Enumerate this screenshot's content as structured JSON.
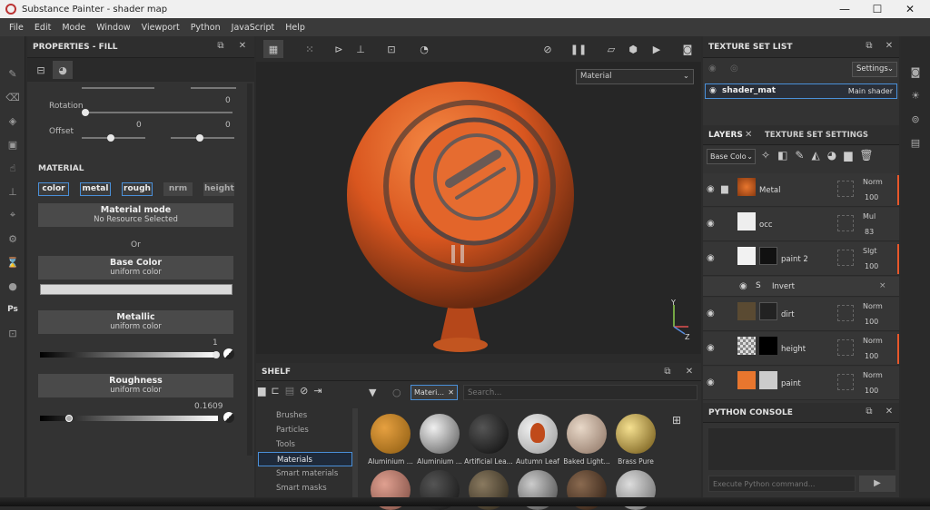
{
  "window": {
    "title": "Substance Painter - shader map",
    "controls": [
      "—",
      "☐",
      "✕"
    ]
  },
  "menu": [
    "File",
    "Edit",
    "Mode",
    "Window",
    "Viewport",
    "Python",
    "JavaScript",
    "Help"
  ],
  "properties": {
    "title": "PROPERTIES - FILL",
    "rotation": {
      "label": "Rotation",
      "value": "0"
    },
    "offset": {
      "label": "Offset",
      "value_x": "0",
      "value_y": "0"
    },
    "material_header": "MATERIAL",
    "channels": [
      {
        "label": "color",
        "on": true
      },
      {
        "label": "metal",
        "on": true
      },
      {
        "label": "rough",
        "on": true
      },
      {
        "label": "nrm",
        "on": false
      },
      {
        "label": "height",
        "on": false
      }
    ],
    "material_mode": {
      "title": "Material mode",
      "sub": "No Resource Selected"
    },
    "or_label": "Or",
    "base_color": {
      "title": "Base Color",
      "sub": "uniform color"
    },
    "metallic": {
      "title": "Metallic",
      "sub": "uniform color",
      "value": "1"
    },
    "roughness": {
      "title": "Roughness",
      "sub": "uniform color",
      "value": "0.1609"
    }
  },
  "viewport": {
    "material_dropdown": "Material",
    "axes": {
      "y": "Y",
      "z": "Z"
    }
  },
  "shelf": {
    "title": "SHELF",
    "filter_tag": "Materi...",
    "search_placeholder": "Search...",
    "categories": [
      "Brushes",
      "Particles",
      "Tools",
      "Materials",
      "Smart materials",
      "Smart masks"
    ],
    "selected_category": "Materials",
    "materials": [
      "Aluminium ...",
      "Aluminium ...",
      "Artificial Lea...",
      "Autumn Leaf",
      "Baked Light...",
      "Brass Pure"
    ]
  },
  "texture_set_list": {
    "title": "TEXTURE SET LIST",
    "settings_label": "Settings",
    "item_name": "shader_mat",
    "item_shader": "Main shader"
  },
  "layers": {
    "tab_layers": "LAYERS",
    "tab_tss": "TEXTURE SET SETTINGS",
    "channel_dropdown": "Base Colo",
    "items": [
      {
        "name": "Metal",
        "blend": "Norm",
        "opacity": "100"
      },
      {
        "name": "occ",
        "blend": "Mul",
        "opacity": "83"
      },
      {
        "name": "paint 2",
        "blend": "Slgt",
        "opacity": "100"
      },
      {
        "name": "Invert"
      },
      {
        "name": "dirt",
        "blend": "Norm",
        "opacity": "100"
      },
      {
        "name": "height",
        "blend": "Norm",
        "opacity": "100"
      },
      {
        "name": "paint",
        "blend": "Norm",
        "opacity": "100"
      }
    ]
  },
  "python_console": {
    "title": "PYTHON CONSOLE",
    "placeholder": "Execute Python command..."
  },
  "colors": {
    "accent": "#4a90d9",
    "orange": "#e8572a"
  }
}
